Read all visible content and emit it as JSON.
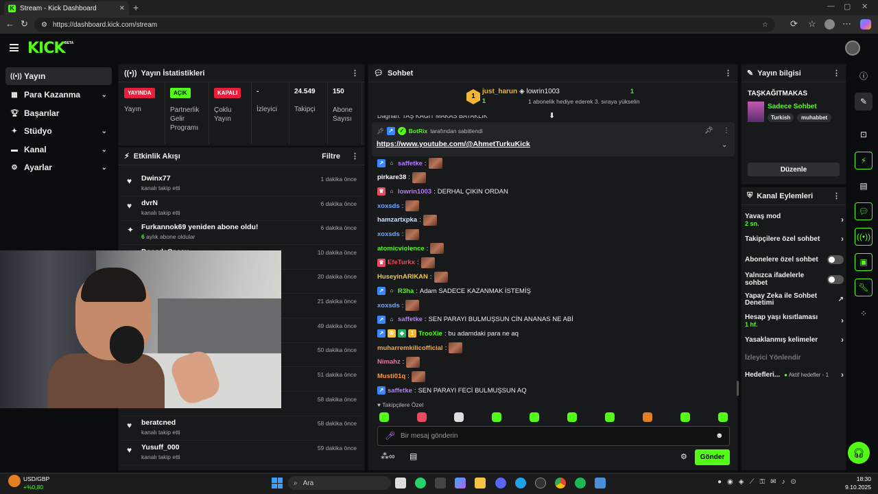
{
  "browser": {
    "tab_title": "Stream - Kick Dashboard",
    "url": "https://dashboard.kick.com/stream"
  },
  "header": {
    "logo": "KICK",
    "beta": "BETA"
  },
  "sidebar": {
    "items": [
      {
        "label": "Yayın",
        "icon": "broadcast-icon",
        "active": true
      },
      {
        "label": "Para Kazanma",
        "icon": "money-icon",
        "chevron": true
      },
      {
        "label": "Başarılar",
        "icon": "trophy-icon"
      },
      {
        "label": "Stüdyo",
        "icon": "studio-icon",
        "chevron": true
      },
      {
        "label": "Kanal",
        "icon": "channel-icon",
        "chevron": true
      },
      {
        "label": "Ayarlar",
        "icon": "gear-icon",
        "chevron": true
      }
    ]
  },
  "stats": {
    "title": "Yayın İstatistikleri",
    "items": [
      {
        "value": "YAYINDA",
        "label": "Yayın",
        "badge_color": "#e91e3a"
      },
      {
        "value": "AÇIK",
        "label": "Partnerlik Gelir Programı",
        "badge_color": "#53fc18"
      },
      {
        "value": "KAPALI",
        "label": "Çoklu Yayın",
        "badge_color": "#e91e3a"
      },
      {
        "value": "-",
        "label": "İzleyici"
      },
      {
        "value": "24.549",
        "label": "Takipçi"
      },
      {
        "value": "150",
        "label": "Abone Sayısı"
      }
    ]
  },
  "activity": {
    "title": "Etkinlik Akışı",
    "filter": "Filtre",
    "items": [
      {
        "name": "Dwinx77",
        "action": "kanalı takip etti",
        "time": "1 dakika önce",
        "icon": "heart-icon"
      },
      {
        "name": "dvrN",
        "action": "kanalı takip etti",
        "time": "6 dakika önce",
        "icon": "heart-icon"
      },
      {
        "name": "Furkannok69 yeniden abone oldu!",
        "action_num": "6",
        "action": "aylık abone oldular",
        "time": "6 dakika önce",
        "icon": "sparkle-icon"
      },
      {
        "name": "DoccdaCeccu",
        "action": "",
        "time": "10 dakika önce",
        "icon": "heart-icon"
      },
      {
        "name": "",
        "action": "",
        "time": "20 dakika önce"
      },
      {
        "name": "",
        "action": "",
        "time": "21 dakika önce"
      },
      {
        "name": "",
        "action": "",
        "time": "49 dakika önce"
      },
      {
        "name": "",
        "action": "",
        "time": "50 dakika önce"
      },
      {
        "name": "",
        "action": "",
        "time": "51 dakika önce"
      },
      {
        "name": "",
        "action": "",
        "time": "58 dakika önce"
      },
      {
        "name": "beratcned",
        "action": "kanalı takip etti",
        "time": "58 dakika önce",
        "icon": "heart-icon"
      },
      {
        "name": "Yusuff_000",
        "action": "kanalı takip etti",
        "time": "59 dakika önce",
        "icon": "heart-icon"
      }
    ]
  },
  "chat": {
    "title": "Sohbet",
    "top_gifter": {
      "rank": "1",
      "name": "just_harun",
      "count": "1"
    },
    "gift_user": {
      "name": "lowrin1003",
      "count": "1",
      "text": "1 abonelik hediye ederek 3. sıraya yükselin"
    },
    "cutoff_line": "Dağhan: TAŞ KAĞIT MAKAS BATAKLIK",
    "pinned": {
      "by": "BotRix",
      "text": "tarafından sabitlendi",
      "link": "https://www.youtube.com/@AhmetTurkuKick"
    },
    "messages": [
      {
        "user": "saffetke",
        "color": "#b57bff",
        "text": "",
        "emote": true
      },
      {
        "user": "pirkare38",
        "color": "#ffffff",
        "text": "",
        "emote": true
      },
      {
        "user": "lowrin1003",
        "color": "#b57bff",
        "text": "DERHAL ÇIKIN ORDAN",
        "emote": false
      },
      {
        "user": "xoxsds",
        "color": "#6fa8ff",
        "text": "",
        "emote": true
      },
      {
        "user": "hamzartxpka",
        "color": "#cfe3ff",
        "text": "",
        "emote": true
      },
      {
        "user": "xoxsds",
        "color": "#6fa8ff",
        "text": "",
        "emote": true
      },
      {
        "user": "atomicviolence",
        "color": "#53fc18",
        "text": "",
        "emote": true
      },
      {
        "user": "EfeTurkx",
        "color": "#e84a5f",
        "text": "",
        "emote": true
      },
      {
        "user": "HuseyinARIKAN",
        "color": "#f2c94c",
        "text": "",
        "emote": true
      },
      {
        "user": "R3ha",
        "color": "#53fc18",
        "text": "Adam SADECE KAZANMAK İSTEMİŞ",
        "emote": false
      },
      {
        "user": "xoxsds",
        "color": "#6fa8ff",
        "text": "",
        "emote": true
      },
      {
        "user": "saffetke",
        "color": "#b57bff",
        "text": "SEN PARAYI BULMUŞSUN CİN ANANAS NE ABİ",
        "emote": false
      },
      {
        "user": "TrooXie",
        "color": "#53fc18",
        "text": "bu adamdaki para ne aq",
        "emote": false
      },
      {
        "user": "muharremkilicofficial",
        "color": "#f2a93b",
        "text": "",
        "emote": true
      },
      {
        "user": "Nimahz",
        "color": "#ff6b9a",
        "text": "",
        "emote": true
      },
      {
        "user": "Musti01q",
        "color": "#ff9a3c",
        "text": "",
        "emote": true
      },
      {
        "user": "saffetke",
        "color": "#b57bff",
        "text": "SEN PARAYI FECİ BULMUŞSUN AQ",
        "emote": false
      }
    ],
    "followers_only": "Takipçilere Özel",
    "input_placeholder": "Bir mesaj gönderin",
    "send": "Gönder"
  },
  "stream_info": {
    "title": "Yayın bilgisi",
    "stream_title": "TAŞKAĞITMAKAS",
    "category": "Sadece Sohbet",
    "tags": [
      "Turkish",
      "muhabbet"
    ],
    "edit": "Düzenle"
  },
  "channel_actions": {
    "title": "Kanal Eylemleri",
    "slow_mode": "Yavaş mod",
    "slow_mode_value": "2 sn.",
    "followers_chat": "Takipçilere özel sohbet",
    "subs_chat": "Abonelere özel sohbet",
    "emotes_only": "Yalnızca ifadelerle sohbet",
    "ai_moderation": "Yapay Zeka ile Sohbet Denetimi",
    "account_age": "Hesap yaşı kısıtlaması",
    "account_age_value": "1 hf.",
    "banned_words": "Yasaklanmış kelimeler",
    "redirect": "İzleyici Yönlendir",
    "goals": "Hedefleri...",
    "goals_value": "Aktif hedefler - 1"
  },
  "taskbar": {
    "currency": "USD/GBP",
    "currency_change": "+%0,80",
    "search": "Ara",
    "time": "18:30",
    "date": "9.10.2025"
  }
}
